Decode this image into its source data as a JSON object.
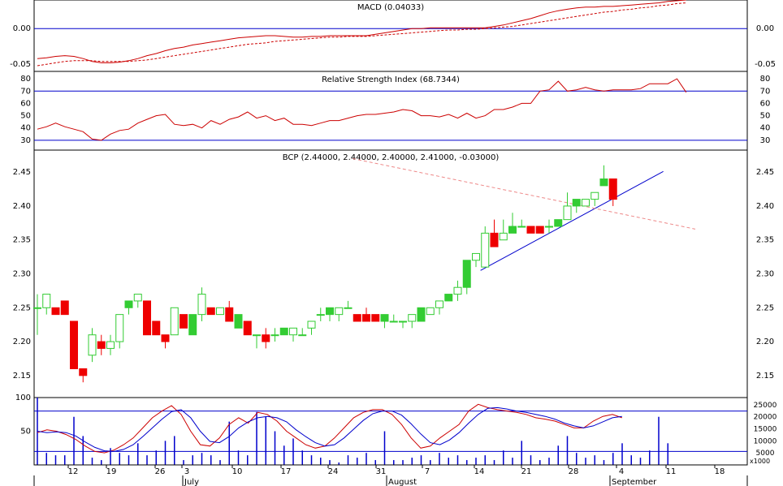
{
  "colors": {
    "background": "#ffffff",
    "panel_border": "#000000",
    "ref_line": "#0000cc",
    "macd_line": "#cc0000",
    "macd_signal": "#cc0000",
    "rsi_line": "#cc0000",
    "candle_up": "#33cc33",
    "candle_down": "#ee0000",
    "trend_support": "#0000cc",
    "trend_resistance": "#ee8888",
    "stoch_k": "#cc0000",
    "stoch_d": "#0000cc",
    "volume_bar": "#0000cc"
  },
  "panels": {
    "macd_title": "MACD (0.04033)",
    "rsi_title": "Relative Strength Index (68.7344)",
    "price_title": "BCP (2.44000, 2.44000, 2.40000, 2.41000, -0.03000)",
    "volume_unit": "x1000"
  },
  "chart_data": [
    {
      "type": "line",
      "name": "macd",
      "title": "MACD (0.04033)",
      "ylim": [
        -0.06,
        0.04
      ],
      "ticks": [
        "0.00",
        "-0.05"
      ],
      "tick_values": [
        0.0,
        -0.05
      ],
      "reference_lines": [
        0.0
      ],
      "series": [
        {
          "role": "macd",
          "style": "solid",
          "values": [
            -0.042,
            -0.041,
            -0.039,
            -0.038,
            -0.039,
            -0.042,
            -0.046,
            -0.048,
            -0.048,
            -0.047,
            -0.045,
            -0.042,
            -0.038,
            -0.035,
            -0.031,
            -0.028,
            -0.026,
            -0.023,
            -0.021,
            -0.019,
            -0.017,
            -0.015,
            -0.013,
            -0.012,
            -0.011,
            -0.01,
            -0.01,
            -0.011,
            -0.012,
            -0.012,
            -0.011,
            -0.011,
            -0.01,
            -0.01,
            -0.01,
            -0.01,
            -0.01,
            -0.008,
            -0.006,
            -0.004,
            -0.002,
            0.0,
            0.0,
            0.001,
            0.001,
            0.001,
            0.001,
            0.001,
            0.001,
            0.001,
            0.003,
            0.005,
            0.008,
            0.011,
            0.014,
            0.018,
            0.022,
            0.025,
            0.027,
            0.029,
            0.03,
            0.03,
            0.031,
            0.031,
            0.032,
            0.033,
            0.034,
            0.035,
            0.036,
            0.038,
            0.039,
            0.04
          ]
        },
        {
          "role": "signal",
          "style": "dashed",
          "values": [
            -0.052,
            -0.05,
            -0.048,
            -0.046,
            -0.045,
            -0.045,
            -0.045,
            -0.046,
            -0.046,
            -0.046,
            -0.046,
            -0.045,
            -0.044,
            -0.042,
            -0.04,
            -0.038,
            -0.036,
            -0.034,
            -0.032,
            -0.03,
            -0.028,
            -0.026,
            -0.024,
            -0.022,
            -0.021,
            -0.02,
            -0.018,
            -0.017,
            -0.016,
            -0.015,
            -0.014,
            -0.013,
            -0.012,
            -0.012,
            -0.011,
            -0.011,
            -0.011,
            -0.01,
            -0.009,
            -0.008,
            -0.007,
            -0.006,
            -0.005,
            -0.004,
            -0.003,
            -0.002,
            -0.002,
            -0.001,
            -0.001,
            0.0,
            0.001,
            0.002,
            0.003,
            0.005,
            0.007,
            0.009,
            0.011,
            0.013,
            0.015,
            0.017,
            0.019,
            0.021,
            0.023,
            0.024,
            0.026,
            0.027,
            0.029,
            0.03,
            0.032,
            0.033,
            0.035,
            0.036
          ]
        }
      ]
    },
    {
      "type": "line",
      "name": "rsi",
      "title": "Relative Strength Index (68.7344)",
      "ylim": [
        22,
        86
      ],
      "ticks": [
        "80",
        "70",
        "60",
        "50",
        "40",
        "30"
      ],
      "tick_values": [
        80,
        70,
        60,
        50,
        40,
        30
      ],
      "reference_lines": [
        70,
        30
      ],
      "series": [
        {
          "role": "rsi",
          "style": "solid",
          "values": [
            39,
            41,
            44,
            41,
            39,
            37,
            31,
            30,
            35,
            38,
            39,
            44,
            47,
            50,
            51,
            43,
            42,
            43,
            40,
            46,
            43,
            47,
            49,
            53,
            48,
            50,
            46,
            48,
            43,
            43,
            42,
            44,
            46,
            46,
            48,
            50,
            51,
            51,
            52,
            53,
            55,
            54,
            50,
            50,
            49,
            51,
            48,
            52,
            48,
            50,
            55,
            55,
            57,
            60,
            60,
            70,
            71,
            78,
            70,
            71,
            73,
            71,
            70,
            71,
            71,
            71,
            72,
            76,
            76,
            76,
            80,
            69
          ]
        }
      ]
    },
    {
      "type": "candlestick",
      "name": "price",
      "title": "BCP (2.44000, 2.44000, 2.40000, 2.41000, -0.03000)",
      "ylim": [
        2.1175,
        2.4825
      ],
      "ticks": [
        "2.45",
        "2.40",
        "2.35",
        "2.30",
        "2.25",
        "2.20",
        "2.15"
      ],
      "tick_values": [
        2.45,
        2.4,
        2.35,
        2.3,
        2.25,
        2.2,
        2.15
      ],
      "candles": [
        {
          "o": 2.25,
          "h": 2.27,
          "l": 2.21,
          "c": 2.25
        },
        {
          "o": 2.25,
          "h": 2.27,
          "l": 2.24,
          "c": 2.27
        },
        {
          "o": 2.25,
          "h": 2.25,
          "l": 2.24,
          "c": 2.24
        },
        {
          "o": 2.26,
          "h": 2.26,
          "l": 2.24,
          "c": 2.24
        },
        {
          "o": 2.23,
          "h": 2.23,
          "l": 2.16,
          "c": 2.16
        },
        {
          "o": 2.16,
          "h": 2.16,
          "l": 2.14,
          "c": 2.15
        },
        {
          "o": 2.18,
          "h": 2.22,
          "l": 2.17,
          "c": 2.21
        },
        {
          "o": 2.2,
          "h": 2.21,
          "l": 2.18,
          "c": 2.19
        },
        {
          "o": 2.19,
          "h": 2.21,
          "l": 2.18,
          "c": 2.2
        },
        {
          "o": 2.2,
          "h": 2.24,
          "l": 2.19,
          "c": 2.24
        },
        {
          "o": 2.25,
          "h": 2.26,
          "l": 2.24,
          "c": 2.26
        },
        {
          "o": 2.26,
          "h": 2.27,
          "l": 2.25,
          "c": 2.27
        },
        {
          "o": 2.26,
          "h": 2.26,
          "l": 2.21,
          "c": 2.21
        },
        {
          "o": 2.23,
          "h": 2.23,
          "l": 2.21,
          "c": 2.21
        },
        {
          "o": 2.21,
          "h": 2.21,
          "l": 2.19,
          "c": 2.2
        },
        {
          "o": 2.21,
          "h": 2.25,
          "l": 2.21,
          "c": 2.25
        },
        {
          "o": 2.24,
          "h": 2.24,
          "l": 2.22,
          "c": 2.22
        },
        {
          "o": 2.21,
          "h": 2.24,
          "l": 2.21,
          "c": 2.24
        },
        {
          "o": 2.24,
          "h": 2.28,
          "l": 2.23,
          "c": 2.27
        },
        {
          "o": 2.25,
          "h": 2.25,
          "l": 2.24,
          "c": 2.24
        },
        {
          "o": 2.24,
          "h": 2.25,
          "l": 2.24,
          "c": 2.25
        },
        {
          "o": 2.25,
          "h": 2.26,
          "l": 2.23,
          "c": 2.23
        },
        {
          "o": 2.22,
          "h": 2.24,
          "l": 2.22,
          "c": 2.24
        },
        {
          "o": 2.23,
          "h": 2.23,
          "l": 2.21,
          "c": 2.21
        },
        {
          "o": 2.21,
          "h": 2.21,
          "l": 2.19,
          "c": 2.21
        },
        {
          "o": 2.21,
          "h": 2.22,
          "l": 2.19,
          "c": 2.2
        },
        {
          "o": 2.21,
          "h": 2.22,
          "l": 2.2,
          "c": 2.21
        },
        {
          "o": 2.21,
          "h": 2.22,
          "l": 2.21,
          "c": 2.22
        },
        {
          "o": 2.21,
          "h": 2.22,
          "l": 2.2,
          "c": 2.22
        },
        {
          "o": 2.21,
          "h": 2.22,
          "l": 2.21,
          "c": 2.21
        },
        {
          "o": 2.22,
          "h": 2.23,
          "l": 2.21,
          "c": 2.23
        },
        {
          "o": 2.24,
          "h": 2.25,
          "l": 2.23,
          "c": 2.24
        },
        {
          "o": 2.24,
          "h": 2.25,
          "l": 2.23,
          "c": 2.25
        },
        {
          "o": 2.24,
          "h": 2.25,
          "l": 2.23,
          "c": 2.25
        },
        {
          "o": 2.25,
          "h": 2.26,
          "l": 2.25,
          "c": 2.25
        },
        {
          "o": 2.24,
          "h": 2.24,
          "l": 2.23,
          "c": 2.23
        },
        {
          "o": 2.24,
          "h": 2.25,
          "l": 2.23,
          "c": 2.23
        },
        {
          "o": 2.24,
          "h": 2.24,
          "l": 2.23,
          "c": 2.23
        },
        {
          "o": 2.23,
          "h": 2.24,
          "l": 2.22,
          "c": 2.24
        },
        {
          "o": 2.23,
          "h": 2.24,
          "l": 2.23,
          "c": 2.23
        },
        {
          "o": 2.23,
          "h": 2.23,
          "l": 2.22,
          "c": 2.23
        },
        {
          "o": 2.23,
          "h": 2.24,
          "l": 2.22,
          "c": 2.24
        },
        {
          "o": 2.23,
          "h": 2.25,
          "l": 2.23,
          "c": 2.25
        },
        {
          "o": 2.24,
          "h": 2.25,
          "l": 2.24,
          "c": 2.25
        },
        {
          "o": 2.25,
          "h": 2.26,
          "l": 2.24,
          "c": 2.26
        },
        {
          "o": 2.26,
          "h": 2.27,
          "l": 2.26,
          "c": 2.27
        },
        {
          "o": 2.27,
          "h": 2.29,
          "l": 2.26,
          "c": 2.28
        },
        {
          "o": 2.28,
          "h": 2.32,
          "l": 2.27,
          "c": 2.32
        },
        {
          "o": 2.32,
          "h": 2.33,
          "l": 2.31,
          "c": 2.33
        },
        {
          "o": 2.31,
          "h": 2.37,
          "l": 2.31,
          "c": 2.36
        },
        {
          "o": 2.36,
          "h": 2.38,
          "l": 2.34,
          "c": 2.34
        },
        {
          "o": 2.35,
          "h": 2.38,
          "l": 2.35,
          "c": 2.36
        },
        {
          "o": 2.36,
          "h": 2.39,
          "l": 2.36,
          "c": 2.37
        },
        {
          "o": 2.37,
          "h": 2.38,
          "l": 2.37,
          "c": 2.37
        },
        {
          "o": 2.37,
          "h": 2.37,
          "l": 2.36,
          "c": 2.36
        },
        {
          "o": 2.37,
          "h": 2.37,
          "l": 2.36,
          "c": 2.36
        },
        {
          "o": 2.37,
          "h": 2.38,
          "l": 2.36,
          "c": 2.37
        },
        {
          "o": 2.37,
          "h": 2.38,
          "l": 2.37,
          "c": 2.38
        },
        {
          "o": 2.38,
          "h": 2.42,
          "l": 2.38,
          "c": 2.4
        },
        {
          "o": 2.4,
          "h": 2.41,
          "l": 2.39,
          "c": 2.41
        },
        {
          "o": 2.4,
          "h": 2.41,
          "l": 2.4,
          "c": 2.41
        },
        {
          "o": 2.41,
          "h": 2.42,
          "l": 2.4,
          "c": 2.42
        },
        {
          "o": 2.43,
          "h": 2.46,
          "l": 2.43,
          "c": 2.44
        },
        {
          "o": 2.44,
          "h": 2.44,
          "l": 2.4,
          "c": 2.41
        }
      ],
      "trendlines": [
        {
          "role": "support",
          "from": {
            "index": 48.5,
            "value": 2.305
          },
          "to": {
            "index": 68.5,
            "value": 2.451
          }
        },
        {
          "role": "resistance",
          "style": "dashed",
          "from": {
            "index": 34.5,
            "value": 2.47
          },
          "to": {
            "index": 72.0,
            "value": 2.366
          }
        }
      ]
    },
    {
      "type": "line_and_bar",
      "name": "stochastic_volume",
      "ylim_left": [
        0,
        100
      ],
      "ticks_left": [
        "100",
        "50"
      ],
      "tick_values_left": [
        100,
        50
      ],
      "ylim_right": [
        0,
        28000
      ],
      "ticks_right": [
        "25000",
        "20000",
        "15000",
        "10000",
        "5000"
      ],
      "tick_values_right": [
        25000,
        20000,
        15000,
        10000,
        5000
      ],
      "right_unit": "x1000",
      "reference_lines": [
        80,
        20
      ],
      "series": [
        {
          "role": "stoch_k",
          "values": [
            48,
            52,
            50,
            45,
            38,
            28,
            20,
            18,
            22,
            30,
            40,
            55,
            70,
            80,
            88,
            75,
            50,
            30,
            28,
            40,
            60,
            70,
            62,
            78,
            75,
            65,
            50,
            40,
            30,
            25,
            28,
            40,
            55,
            70,
            78,
            82,
            82,
            75,
            60,
            40,
            25,
            28,
            40,
            50,
            60,
            80,
            90,
            85,
            82,
            80,
            78,
            75,
            70,
            68,
            65,
            60,
            55,
            55,
            65,
            72,
            75,
            70
          ]
        },
        {
          "role": "stoch_d",
          "values": [
            50,
            48,
            49,
            48,
            43,
            34,
            26,
            21,
            20,
            23,
            30,
            42,
            55,
            68,
            79,
            82,
            70,
            50,
            35,
            33,
            42,
            55,
            64,
            70,
            72,
            70,
            64,
            52,
            42,
            33,
            28,
            30,
            40,
            53,
            66,
            76,
            80,
            80,
            74,
            61,
            46,
            33,
            30,
            37,
            48,
            62,
            75,
            84,
            85,
            83,
            80,
            78,
            75,
            72,
            68,
            62,
            58,
            55,
            58,
            64,
            70,
            72
          ]
        },
        {
          "role": "volume",
          "values": [
            28000,
            5000,
            4000,
            4000,
            20000,
            12000,
            3000,
            2000,
            7000,
            5000,
            4000,
            9000,
            4000,
            6000,
            10000,
            12000,
            2000,
            4000,
            5000,
            4000,
            2000,
            18000,
            6000,
            4000,
            22000,
            20000,
            14000,
            8000,
            11000,
            6000,
            4000,
            3000,
            2000,
            1000,
            4000,
            3000,
            5000,
            2000,
            14000,
            2000,
            2000,
            3000,
            4000,
            2000,
            5000,
            3000,
            4000,
            2000,
            3000,
            4000,
            2000,
            6000,
            3000,
            10000,
            4000,
            2000,
            3000,
            8000,
            12000,
            5000,
            3000,
            4000,
            2000,
            5000,
            9000,
            4000,
            3000,
            6000,
            20000,
            9000
          ]
        }
      ],
      "x_day_labels": [
        "12",
        "19",
        "26",
        "3",
        "10",
        "17",
        "24",
        "31",
        "7",
        "14",
        "21",
        "28",
        "4",
        "11",
        "18"
      ],
      "x_month_labels": [
        "July",
        "August",
        "September"
      ]
    }
  ]
}
